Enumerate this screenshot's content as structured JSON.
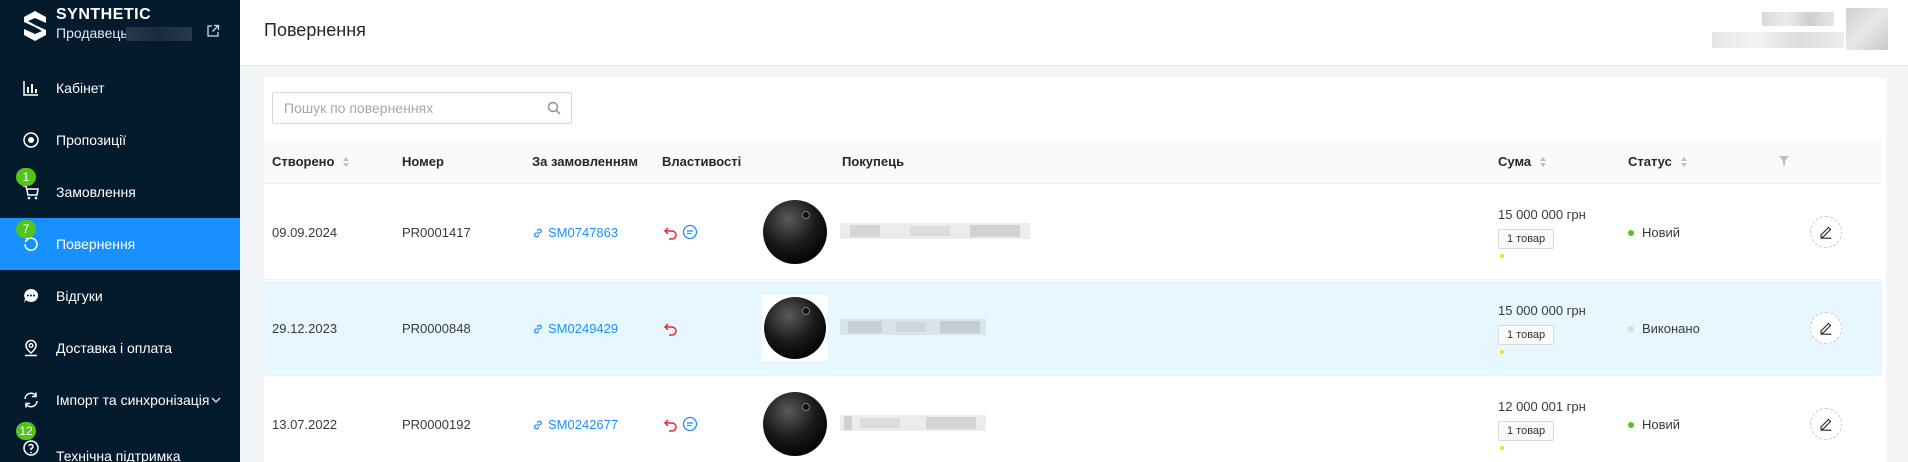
{
  "brand": {
    "title": "SYNTHETIC",
    "subtitle": "Продавець"
  },
  "sidebar": {
    "items": [
      {
        "label": "Кабінет",
        "icon": "bar-chart-icon",
        "badge": null,
        "active": false
      },
      {
        "label": "Пропозиції",
        "icon": "offers-icon",
        "badge": null,
        "active": false
      },
      {
        "label": "Замовлення",
        "icon": "cart-icon",
        "badge": "1",
        "active": false
      },
      {
        "label": "Повернення",
        "icon": "returns-icon",
        "badge": "7",
        "active": true
      },
      {
        "label": "Відгуки",
        "icon": "chat-icon",
        "badge": null,
        "active": false
      },
      {
        "label": "Доставка і оплата",
        "icon": "location-pin-icon",
        "badge": null,
        "active": false
      },
      {
        "label": "Імпорт та синхронізація",
        "icon": "sync-icon",
        "badge": null,
        "active": false
      },
      {
        "label": "Технічна підтримка",
        "icon": "help-icon",
        "badge": "12",
        "active": false
      }
    ]
  },
  "header": {
    "title": "Повернення"
  },
  "search": {
    "placeholder": "Пошук по поверненнях",
    "value": ""
  },
  "table": {
    "columns": {
      "created": "Створено",
      "number": "Номер",
      "order": "За замовленням",
      "properties": "Властивості",
      "buyer": "Покупець",
      "sum": "Сума",
      "status": "Статус"
    },
    "rows": [
      {
        "created": "09.09.2024",
        "number": "PR0001417",
        "order": "SM0747863",
        "props": [
          "return-arrow-icon",
          "comment-icon"
        ],
        "sum": "15 000 000 грн",
        "goods": "1 товар",
        "status": "Новий",
        "status_color": "#52c41a",
        "highlighted": false
      },
      {
        "created": "29.12.2023",
        "number": "PR0000848",
        "order": "SM0249429",
        "props": [
          "return-arrow-icon"
        ],
        "sum": "15 000 000 грн",
        "goods": "1 товар",
        "status": "Виконано",
        "status_color": "#d9d9d9",
        "highlighted": true
      },
      {
        "created": "13.07.2022",
        "number": "PR0000192",
        "order": "SM0242677",
        "props": [
          "return-arrow-icon",
          "comment-icon"
        ],
        "sum": "12 000 001 грн",
        "goods": "1 товар",
        "status": "Новий",
        "status_color": "#52c41a",
        "highlighted": false
      }
    ]
  },
  "colors": {
    "sidebar_bg": "#041b2d",
    "accent": "#1890ff",
    "badge": "#52c41a",
    "return_icon": "#f5222d",
    "highlight_row": "#e6f7ff"
  }
}
